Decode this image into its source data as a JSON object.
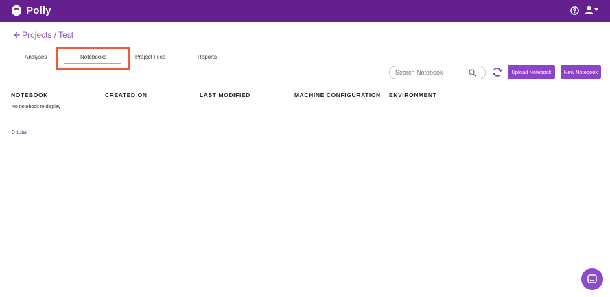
{
  "app": {
    "brand": "Polly",
    "accent_color": "#64208f",
    "icons": [
      "polly-logo-icon",
      "help-icon",
      "user-icon",
      "caret-down-icon"
    ]
  },
  "breadcrumb": {
    "text": "Projects / Test",
    "icon": "arrow-left-icon"
  },
  "tabs": [
    {
      "label": "Analyses",
      "active": false
    },
    {
      "label": "Notebooks",
      "active": true
    },
    {
      "label": "Project Files",
      "active": false
    },
    {
      "label": "Reports",
      "active": false
    }
  ],
  "toolbar": {
    "search_placeholder": "Search Notebook",
    "search_value": "",
    "refresh_icon": "refresh-icon",
    "upload_label": "Upload Notebook",
    "new_label": "New Notebook",
    "button_color": "#8e44c6"
  },
  "table": {
    "columns": [
      "NOTEBOOK",
      "CREATED ON",
      "LAST MODIFIED",
      "MACHINE CONFIGURATION",
      "ENVIRONMENT"
    ],
    "empty_message": "No notebook to display",
    "rows": []
  },
  "footer": {
    "total_text": "0 total"
  },
  "chat": {
    "icon": "chat-icon"
  }
}
